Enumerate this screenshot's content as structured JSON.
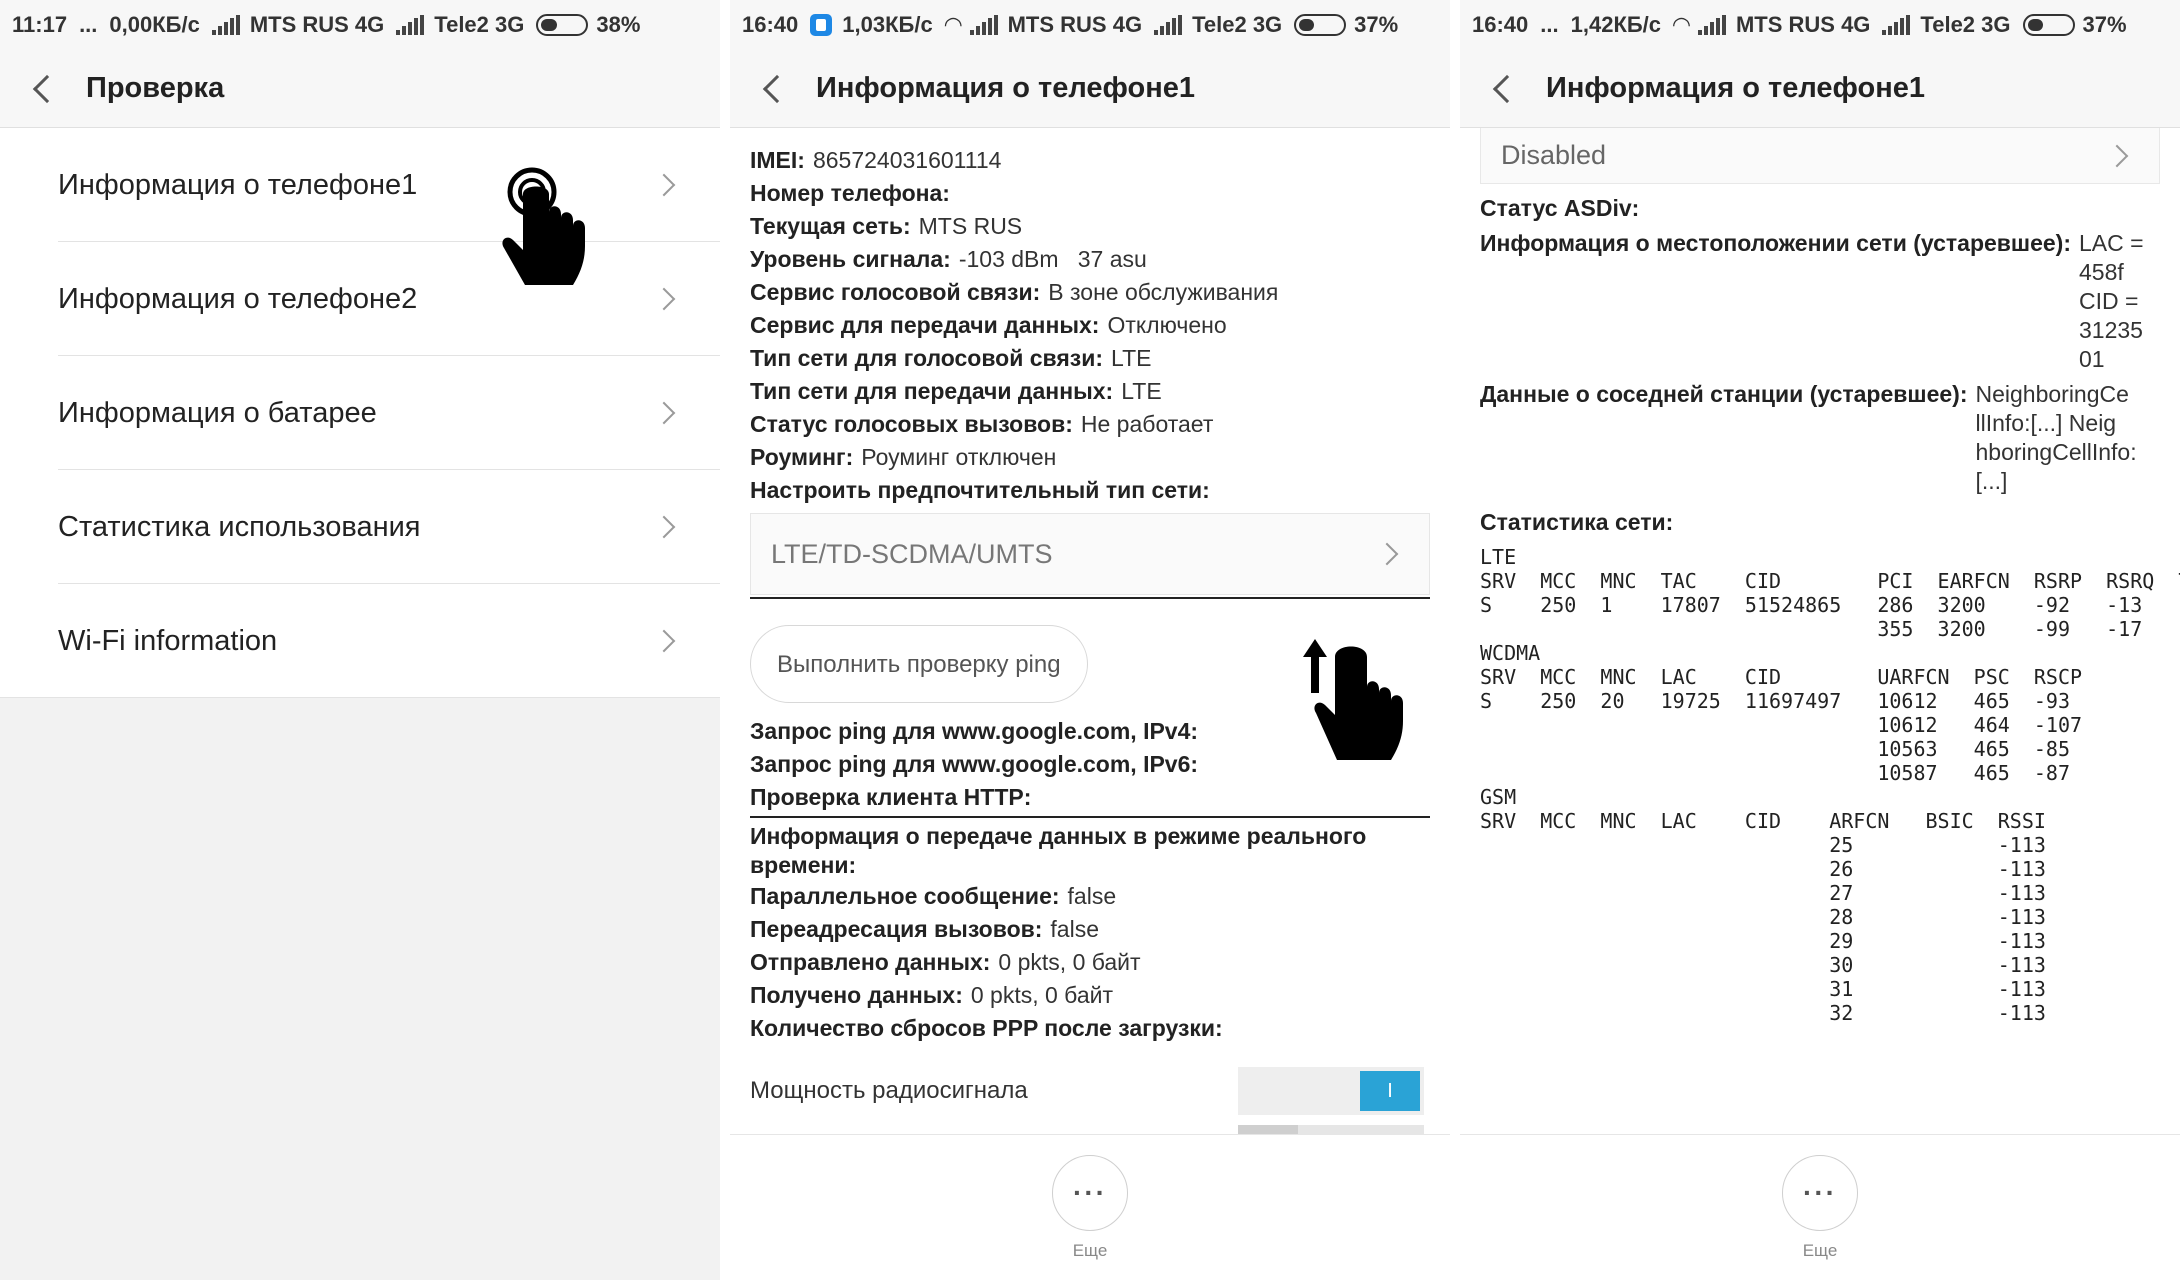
{
  "screen1": {
    "status": {
      "time": "11:17",
      "dots": "...",
      "speed": "0,00КБ/с",
      "op1": "MTS RUS 4G",
      "op2": "Tele2 3G",
      "battery": "38%",
      "battery_level": 0.38
    },
    "header": {
      "title": "Проверка"
    },
    "items": [
      {
        "label": "Информация о телефоне1"
      },
      {
        "label": "Информация о телефоне2"
      },
      {
        "label": "Информация о батарее"
      },
      {
        "label": "Статистика использования"
      },
      {
        "label": "Wi-Fi information"
      }
    ]
  },
  "screen2": {
    "status": {
      "time": "16:40",
      "speed": "1,03КБ/с",
      "op1": "MTS RUS 4G",
      "op2": "Tele2 3G",
      "battery": "37%",
      "battery_level": 0.37
    },
    "header": {
      "title": "Информация о телефоне1"
    },
    "lines": [
      {
        "k": "IMEI:",
        "v": "865724031601114"
      },
      {
        "k": "Номер телефона:",
        "v": ""
      },
      {
        "k": "Текущая сеть:",
        "v": "MTS RUS"
      },
      {
        "k": "Уровень сигнала:",
        "v": "-103 dBm   37 asu"
      },
      {
        "k": "Сервис голосовой связи:",
        "v": "В зоне обслуживания"
      },
      {
        "k": "Сервис для передачи данных:",
        "v": "Отключено"
      },
      {
        "k": "Тип сети для голосовой связи:",
        "v": "LTE"
      },
      {
        "k": "Тип сети для передачи данных:",
        "v": "LTE"
      },
      {
        "k": "Статус голосовых вызовов:",
        "v": "Не работает"
      },
      {
        "k": "Роуминг:",
        "v": "Роуминг отключен"
      },
      {
        "k": "Настроить предпочтительный тип сети:",
        "v": ""
      }
    ],
    "network_select": "LTE/TD-SCDMA/UMTS",
    "ping_button": "Выполнить проверку ping",
    "ping_lines": [
      {
        "k": "Запрос ping для www.google.com, IPv4:",
        "v": ""
      },
      {
        "k": "Запрос ping для www.google.com, IPv6:",
        "v": ""
      },
      {
        "k": "Проверка клиента HTTP:",
        "v": ""
      }
    ],
    "realtime_title": "Информация о передаче данных в режиме реального времени:",
    "data_lines": [
      {
        "k": "Параллельное сообщение:",
        "v": "false"
      },
      {
        "k": "Переадресация вызовов:",
        "v": "false"
      },
      {
        "k": "Отправлено данных:",
        "v": "0 pkts, 0 байт"
      },
      {
        "k": "Получено данных:",
        "v": "0 pkts, 0 байт"
      },
      {
        "k": "Количество сбросов PPP после загрузки:",
        "v": ""
      }
    ],
    "radio_power_label": "Мощность радиосигнала",
    "toggle_on_label": "I",
    "more_label": "Еще",
    "more_dots": "···"
  },
  "screen3": {
    "status": {
      "time": "16:40",
      "dots": "...",
      "speed": "1,42КБ/с",
      "op1": "MTS RUS 4G",
      "op2": "Tele2 3G",
      "battery": "37%",
      "battery_level": 0.37
    },
    "header": {
      "title": "Информация о телефоне1"
    },
    "disabled_value": "Disabled",
    "asdiv_label": "Статус ASDiv:",
    "location_label": "Информация о местоположении сети (устаревшее):",
    "location_value": "LAC =\n458f\nCID =\n31235\n01",
    "neighbor_label": "Данные о соседней станции (устаревшее):",
    "neighbor_value": "NeighboringCe\nllInfo:[...] Neig\nhboringCellInfo:\n[...]",
    "stats_label": "Статистика сети:",
    "stats_text": "LTE\nSRV  MCC  MNC  TAC    CID        PCI  EARFCN  RSRP  RSRQ  TA\nS    250  1    17807  51524865   286  3200    -92   -13\n                                 355  3200    -99   -17\nWCDMA\nSRV  MCC  MNC  LAC    CID        UARFCN  PSC  RSCP\nS    250  20   19725  11697497   10612   465  -93\n                                 10612   464  -107\n                                 10563   465  -85\n                                 10587   465  -87\nGSM\nSRV  MCC  MNC  LAC    CID    ARFCN   BSIC  RSSI\n                             25            -113\n                             26            -113\n                             27            -113\n                             28            -113\n                             29            -113\n                             30            -113\n                             31            -113\n                             32            -113",
    "more_label": "Еще",
    "more_dots": "···"
  }
}
